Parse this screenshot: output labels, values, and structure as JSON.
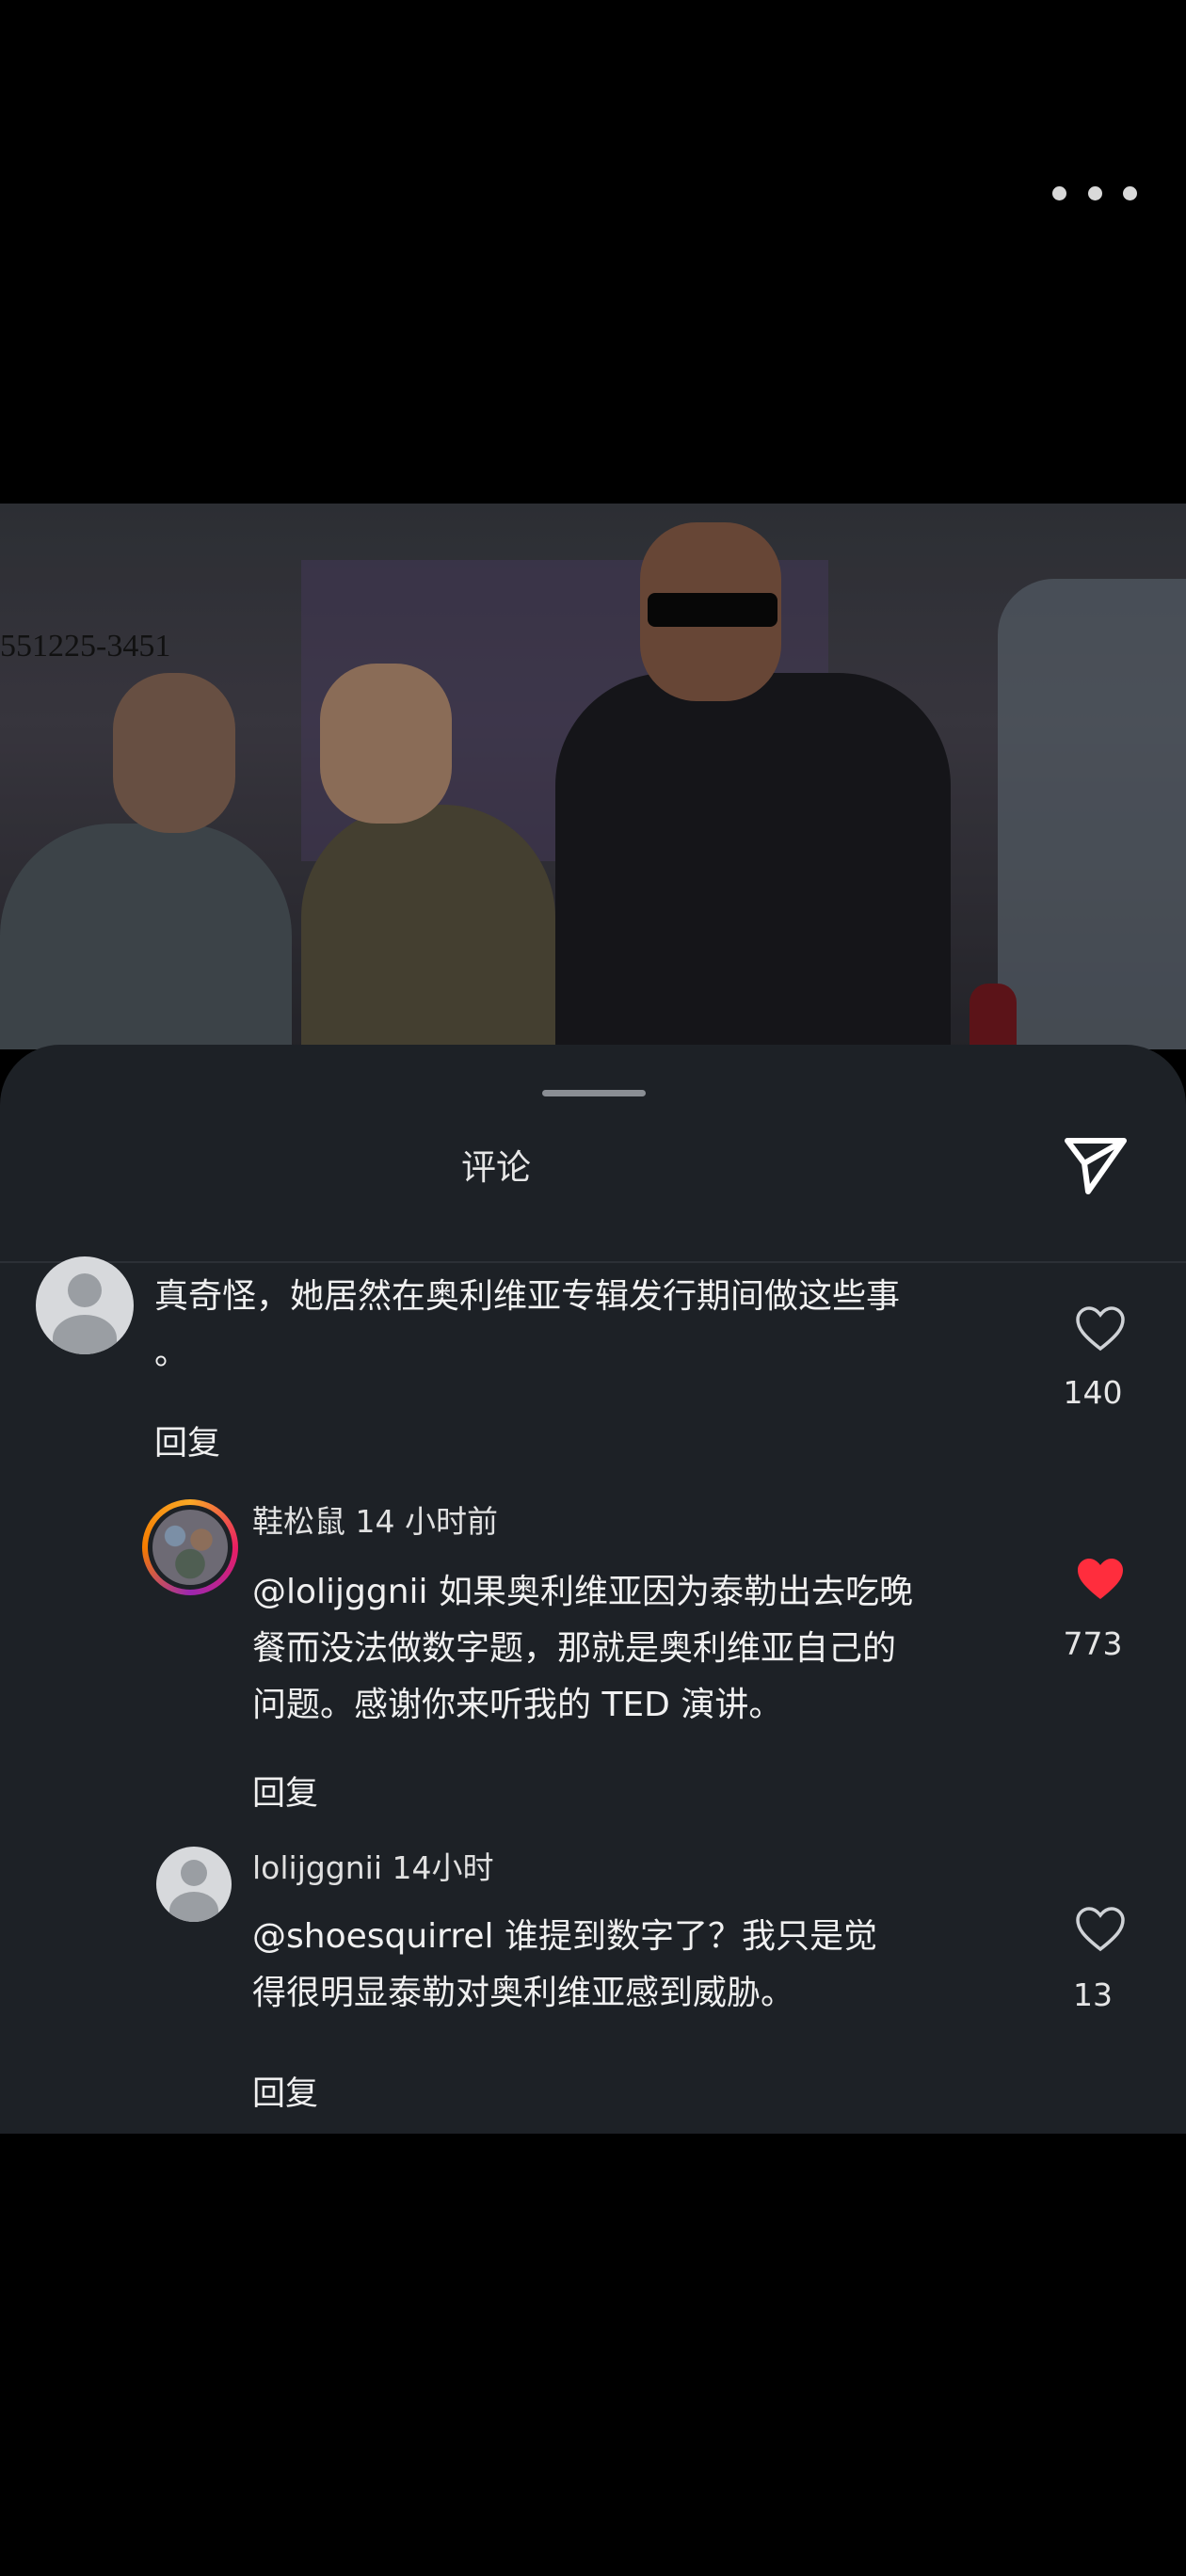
{
  "photo": {
    "id_text": "551225-3451"
  },
  "sheet": {
    "title": "评论"
  },
  "comments": [
    {
      "text": "真奇怪，她居然在奥利维亚专辑发行期间做这些事\n。",
      "reply": "回复",
      "likes": "140",
      "liked": false
    },
    {
      "author_meta": "鞋松鼠 14 小时前",
      "text": "@lolijggnii 如果奥利维亚因为泰勒出去吃晚\n餐而没法做数字题，那就是奥利维亚自己的\n问题。感谢你来听我的 TED 演讲。",
      "reply": "回复",
      "likes": "773",
      "liked": true
    },
    {
      "author_meta": "lolijggnii 14小时",
      "text": "@shoesquirrel 谁提到数字了？我只是觉\n得很明显泰勒对奥利维亚感到威胁。",
      "reply": "回复",
      "likes": "13",
      "liked": false
    }
  ],
  "colors": {
    "liked": "#ff2d3d",
    "sheet_bg": "#1d2126"
  }
}
